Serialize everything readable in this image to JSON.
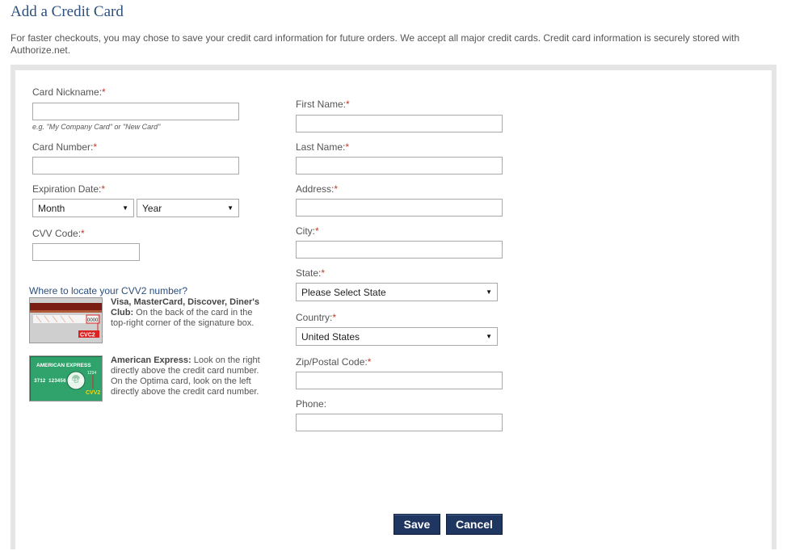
{
  "page": {
    "title": "Add a Credit Card",
    "intro": "For faster checkouts, you may chose to save your credit card information for future orders. We accept all major credit cards. Credit card information is securely stored with Authorize.net."
  },
  "form": {
    "required_mark": "*",
    "card_nickname": {
      "label": "Card Nickname:",
      "value": "",
      "hint": "e.g. \"My Company Card\" or \"New Card\""
    },
    "card_number": {
      "label": "Card Number:",
      "value": ""
    },
    "expiration": {
      "label": "Expiration Date:",
      "month": "Month",
      "year": "Year"
    },
    "cvv": {
      "label": "CVV Code:",
      "value": ""
    },
    "first_name": {
      "label": "First Name:",
      "value": ""
    },
    "last_name": {
      "label": "Last Name:",
      "value": ""
    },
    "address": {
      "label": "Address:",
      "value": ""
    },
    "city": {
      "label": "City:",
      "value": ""
    },
    "state": {
      "label": "State:",
      "selected": "Please Select State"
    },
    "country": {
      "label": "Country:",
      "selected": "United States"
    },
    "zip": {
      "label": "Zip/Postal Code:",
      "value": ""
    },
    "phone": {
      "label": "Phone:",
      "value": ""
    }
  },
  "cvv_help": {
    "link": "Where to locate your CVV2 number?",
    "visa_title": "Visa, MasterCard, Discover, Diner's Club:",
    "visa_text": " On the back of the card in the top-right corner of the signature box.",
    "amex_title": "American Express:",
    "amex_text": " Look on the right directly above the credit card number. On the Optima card, look on the left directly above the credit card number.",
    "visa_card_code": "0000",
    "visa_card_label": "CVC2",
    "amex_card_brand": "AMERICAN EXPRESS",
    "amex_card_number": "3712 123456 12345",
    "amex_card_code": "1234",
    "amex_card_label": "CVV2"
  },
  "buttons": {
    "save": "Save",
    "cancel": "Cancel"
  },
  "colors": {
    "accent": "#2c4f7c",
    "button": "#1f3660",
    "required": "#c0392b",
    "amex_green": "#2fa36b"
  }
}
